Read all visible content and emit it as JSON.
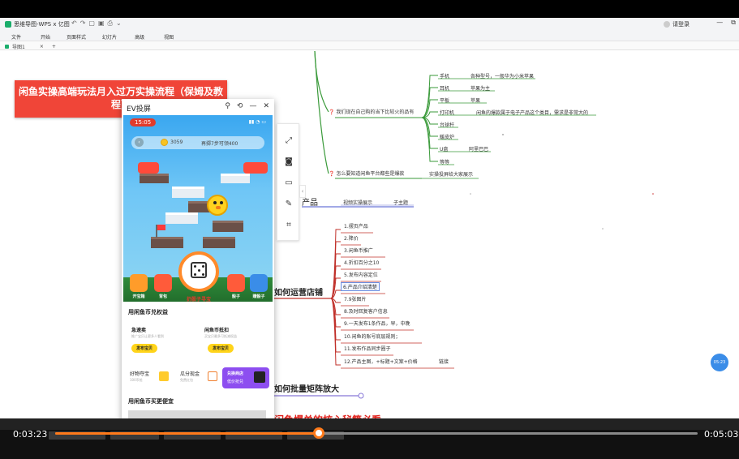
{
  "window": {
    "app_title": "思维导图-WPS x 亿图",
    "user_label": "请登录",
    "menu": [
      "文件",
      "开始",
      "页面样式",
      "幻灯片",
      "高级",
      "视图"
    ],
    "doc_tab": "导图1"
  },
  "banner": {
    "text": "闲鱼实操高端玩法月入过万实操流程（保姆及教程）"
  },
  "mindmap": {
    "topic_q1": "我们现在自己购的当下比较火的品有",
    "topic_q2": "怎么要知道闲鱼平台都些是爆款",
    "q2_child": "实操投屏给大家展示",
    "items_top": [
      {
        "label": "手机",
        "desc": "各种型号，一般华为小米苹果"
      },
      {
        "label": "耳机",
        "desc": "苹果为主"
      },
      {
        "label": "平板",
        "desc": "苹果"
      },
      {
        "label": "打印机",
        "desc": "闲鱼的爆款属于电子产品这个类目，需求是非常大的"
      },
      {
        "label": "台球杆",
        "desc": ""
      },
      {
        "label": "暖皮炉",
        "desc": ""
      },
      {
        "label": "U盘",
        "desc": "阿里巴巴"
      },
      {
        "label": "等等",
        "desc": ""
      }
    ],
    "product_partial": "产品",
    "video_label": "视频实操展示",
    "subtopic": "子主题",
    "store_title": "如何运营店铺",
    "store_items": [
      "1.摆页产品",
      "2.降价",
      "3.闲鱼币推广",
      "4.折扣百分之10",
      "5.发布内容定位",
      "6.产品介绍清楚",
      "7.9张图片",
      "8.及时回复客户信息",
      "9.一天发布1条作品，早，中晚",
      "10.闲鱼的账号底层规则；",
      "11.发布作品同步圈子",
      "12.产品主图，+标题+文案+价格"
    ],
    "last_extra": "链接",
    "batch_title": "如何批量矩阵放大",
    "secret_title": "闲鱼爆单的核心秘籍必看"
  },
  "ev": {
    "title": "EV投屏",
    "phone_time": "15:05",
    "coins_left": "3059",
    "coins_mid": "再掷7步可领400",
    "dice_label": "扔骰子寻宝",
    "game_tabs": [
      "开宝箱",
      "背包",
      "骰子",
      "赚骰子"
    ],
    "benefits_title": "用闲鱼币兑权益",
    "card1_title": "急速卖",
    "card1_desc": "推广宝贝让更多人看到",
    "card1_btn": "发布宝贝",
    "card2_title": "闲鱼币抵扣",
    "card2_desc": "买宝贝最多可抵减权益",
    "card2_btn": "发布宝贝",
    "row2_a": "好物夺宝",
    "row2_a_sub": "100币抢",
    "row2_b": "瓜分现金",
    "row2_b_sub": "免费红包",
    "redeem_title": "兑换商店",
    "redeem_sub": "低价抢兑",
    "cheaper_title": "用闲鱼币买更便宜"
  },
  "float_badge": "05:23",
  "player": {
    "current_time": "0:03:23",
    "total_time": "0:05:03",
    "progress_fraction": 0.41,
    "accent": "#ff7a1a"
  }
}
